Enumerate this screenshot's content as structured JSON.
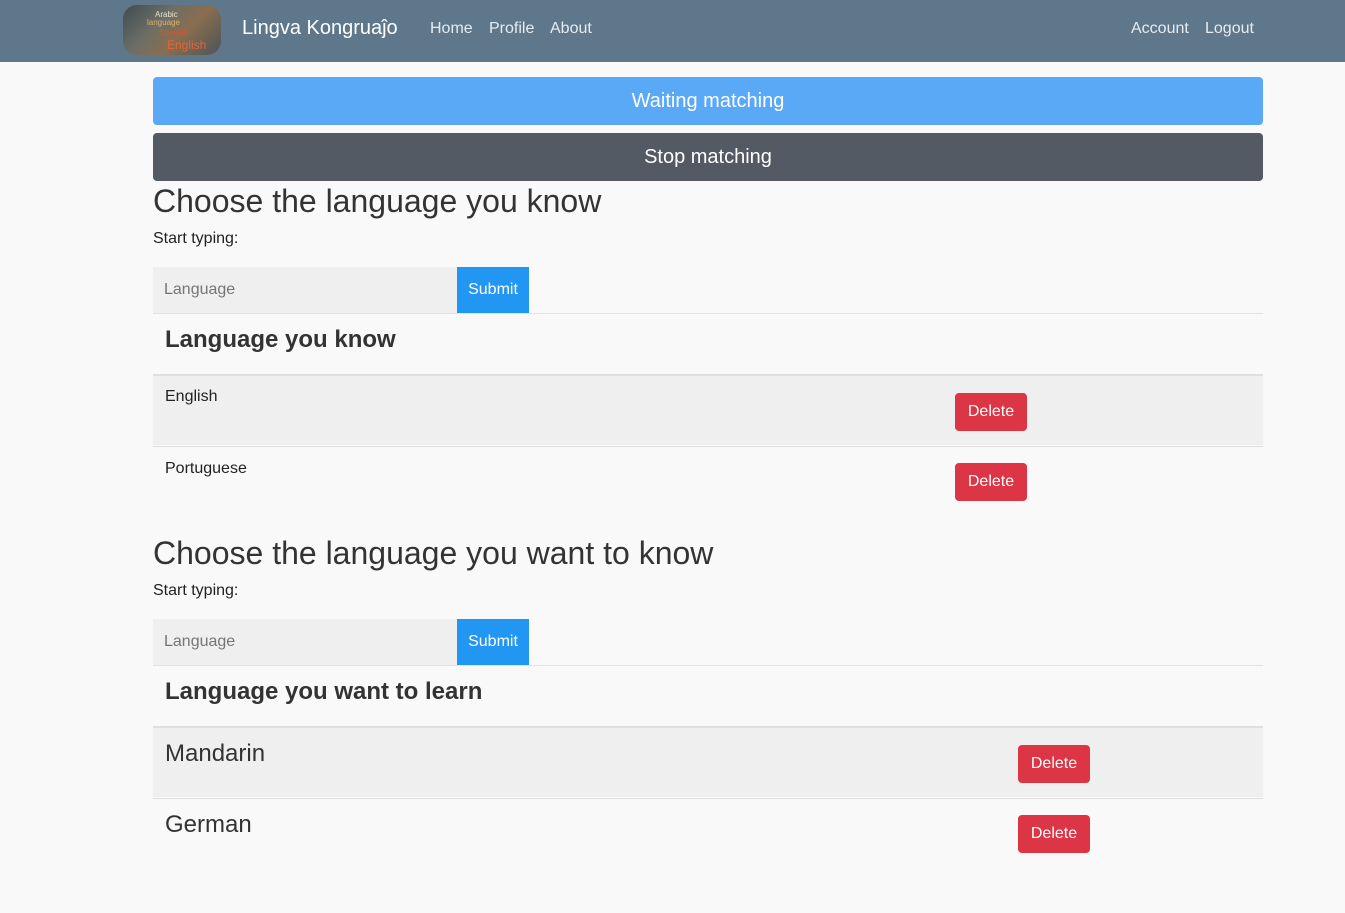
{
  "navbar": {
    "brand": "Lingva Kongruaĵo",
    "logo_words": [
      "Arabic",
      "language",
      "Spanish",
      "English"
    ],
    "links": [
      "Home",
      "Profile",
      "About"
    ],
    "account": "Account",
    "logout": "Logout",
    "color": "#5f778b"
  },
  "matching": {
    "waiting_label": "Waiting matching",
    "stop_label": "Stop matching"
  },
  "known": {
    "title": "Choose the language you know",
    "hint": "Start typing:",
    "placeholder": "Language",
    "submit": "Submit",
    "table_header": "Language you know",
    "rows": [
      {
        "name": "English",
        "action": "Delete"
      },
      {
        "name": "Portuguese",
        "action": "Delete"
      }
    ]
  },
  "learn": {
    "title": "Choose the language you want to know",
    "hint": "Start typing:",
    "placeholder": "Language",
    "submit": "Submit",
    "table_header": "Language you want to learn",
    "rows": [
      {
        "name": "Mandarin",
        "action": "Delete"
      },
      {
        "name": "German",
        "action": "Delete"
      }
    ]
  },
  "colors": {
    "primary": "#2196f3",
    "waiting": "#5aa9f7",
    "stop": "#545a63",
    "danger": "#dc3545"
  }
}
